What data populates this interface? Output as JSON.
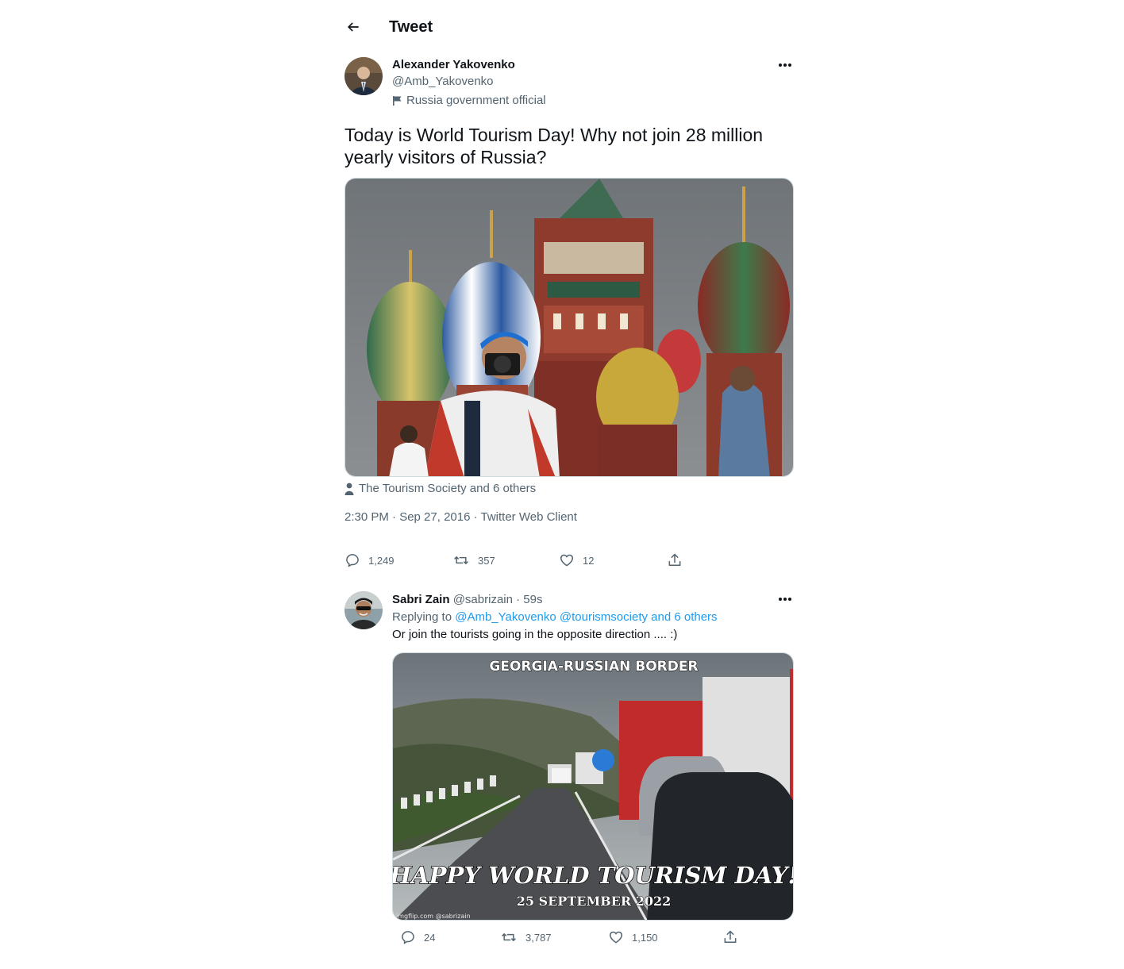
{
  "header": {
    "title": "Tweet",
    "back_icon": "arrow-left-icon"
  },
  "main_tweet": {
    "author_name": "Alexander Yakovenko",
    "author_handle": "@Amb_Yakovenko",
    "author_label": "Russia government official",
    "text": "Today is World Tourism Day! Why not join 28 million yearly visitors of Russia?",
    "media_tag": "The Tourism Society and 6 others",
    "timestamp": "2:30 PM · Sep 27, 2016 · Twitter Web Client",
    "stats": {
      "replies": "1,249",
      "retweets": "357",
      "likes": "12"
    }
  },
  "reply_tweet": {
    "author_name": "Sabri Zain",
    "author_handle": "@sabrizain",
    "time": "· 59s",
    "replying_prefix": "Replying to",
    "replying_to": "@Amb_Yakovenko @tourismsociety and 6 others",
    "text": "Or join the tourists going in the opposite direction .... :)",
    "meme_top": "GEORGIA-RUSSIAN BORDER",
    "meme_bottom": "HAPPY WORLD TOURISM DAY!",
    "meme_date": "25 SEPTEMBER 2022",
    "meme_watermark": "imgflip.com @sabrizain",
    "stats": {
      "replies": "24",
      "retweets": "3,787",
      "likes": "1,150"
    }
  },
  "colors": {
    "text": "#0f1419",
    "secondary": "#536471",
    "link": "#1d9bf0",
    "border": "#cfd9de"
  }
}
